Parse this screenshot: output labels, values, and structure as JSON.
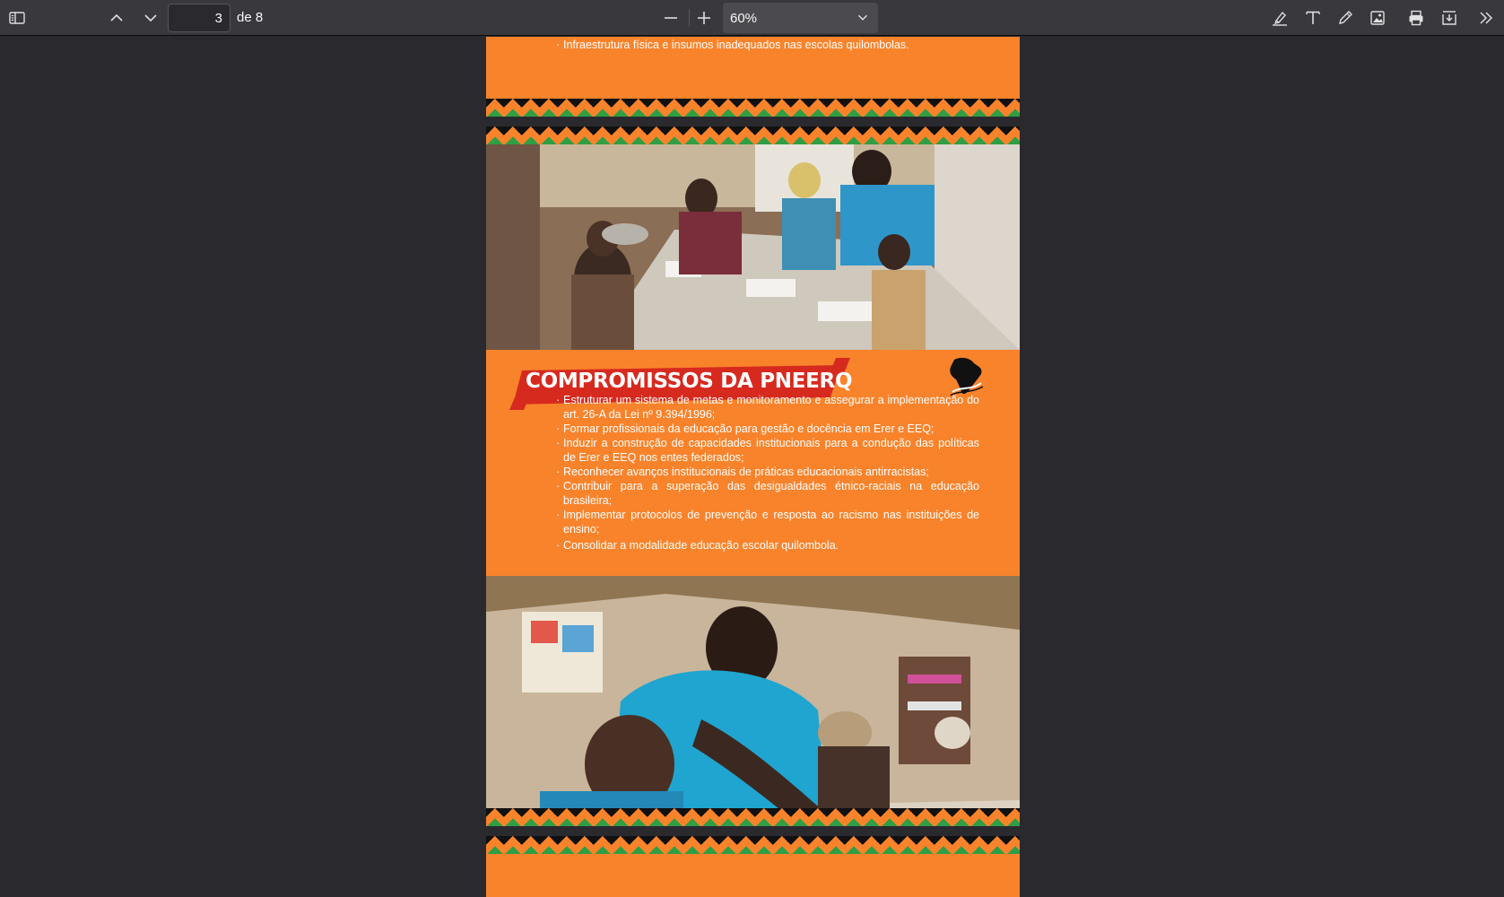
{
  "toolbar": {
    "page_current": "3",
    "page_count_label": "de 8",
    "zoom_value": "60%",
    "icons": {
      "sidebar": "sidebar-toggle-icon",
      "prev": "chevron-up-icon",
      "next": "chevron-down-icon",
      "zoom_out": "minus-icon",
      "zoom_in": "plus-icon",
      "highlight": "highlighter-icon",
      "text": "text-icon",
      "draw": "pen-icon",
      "image": "image-icon",
      "print": "printer-icon",
      "save": "download-icon",
      "more": "double-chevron-right-icon"
    }
  },
  "document": {
    "previous_item": "Infraestrutura física e insumos inadequados nas escolas quilombolas.",
    "heading": "COMPROMISSOS DA PNEERQ",
    "items": [
      "Estruturar um sistema de metas e monitoramento e assegurar a implementação do art. 26-A da Lei nº 9.394/1996;",
      "Formar profissionais da educação para gestão e docência em Erer e EEQ;",
      "Induzir a construção de capacidades institucionais para a condução das políticas de Erer e EEQ nos entes federados;",
      "Reconhecer avanços institucionais de práticas educacionais antirracistas;",
      "Contribuir para a superação das desigualdades étnico-raciais na educação brasileira;",
      "Implementar protocolos de prevenção e resposta ao racismo nas instituições de ensino;",
      "Consolidar a modalidade educação escolar quilombola."
    ],
    "colors": {
      "accent_orange": "#f9832b",
      "banner_red": "#d72a1f",
      "pattern_black": "#111111",
      "pattern_green": "#2f9e44"
    }
  }
}
